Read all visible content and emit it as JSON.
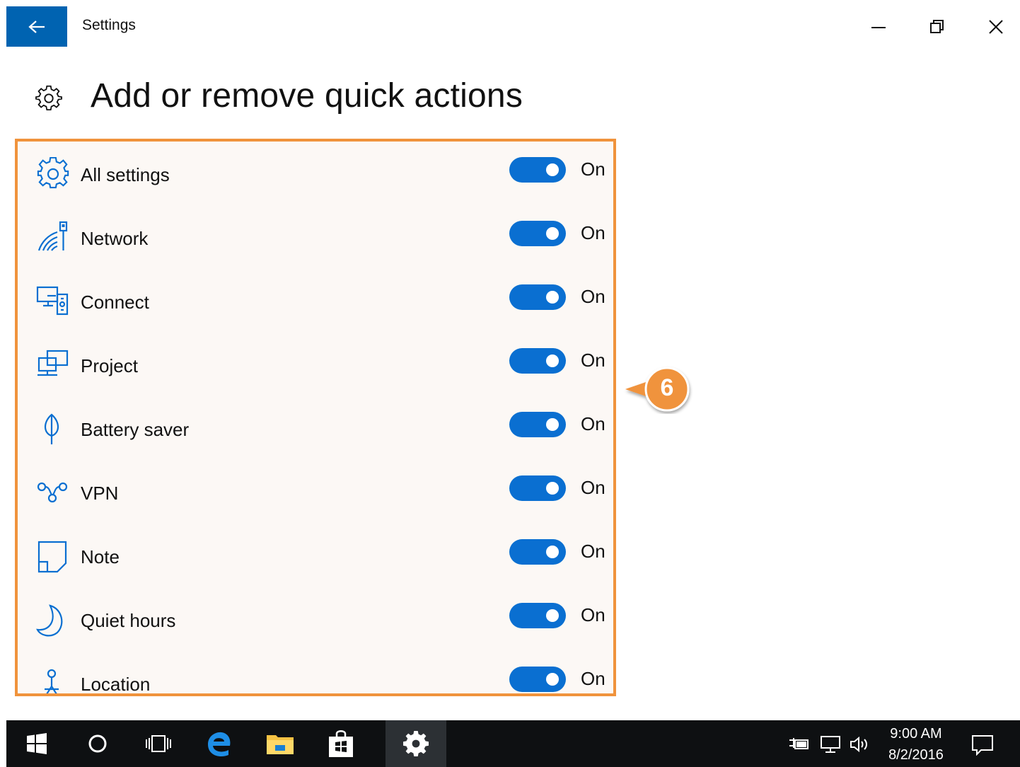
{
  "window": {
    "title": "Settings"
  },
  "page": {
    "title": "Add or remove quick actions"
  },
  "quick_actions": [
    {
      "label": "All settings",
      "icon": "gear-icon",
      "state": "On",
      "on": true
    },
    {
      "label": "Network",
      "icon": "network-icon",
      "state": "On",
      "on": true
    },
    {
      "label": "Connect",
      "icon": "connect-icon",
      "state": "On",
      "on": true
    },
    {
      "label": "Project",
      "icon": "project-icon",
      "state": "On",
      "on": true
    },
    {
      "label": "Battery saver",
      "icon": "battery-saver-icon",
      "state": "On",
      "on": true
    },
    {
      "label": "VPN",
      "icon": "vpn-icon",
      "state": "On",
      "on": true
    },
    {
      "label": "Note",
      "icon": "note-icon",
      "state": "On",
      "on": true
    },
    {
      "label": "Quiet hours",
      "icon": "moon-icon",
      "state": "On",
      "on": true
    },
    {
      "label": "Location",
      "icon": "location-icon",
      "state": "On",
      "on": true
    }
  ],
  "callout": {
    "number": "6"
  },
  "taskbar": {
    "time": "9:00 AM",
    "date": "8/2/2016"
  },
  "colors": {
    "accent": "#0063b1",
    "toggle_on": "#0a6fd1",
    "highlight_border": "#f0933c",
    "taskbar": "#0e1012"
  }
}
